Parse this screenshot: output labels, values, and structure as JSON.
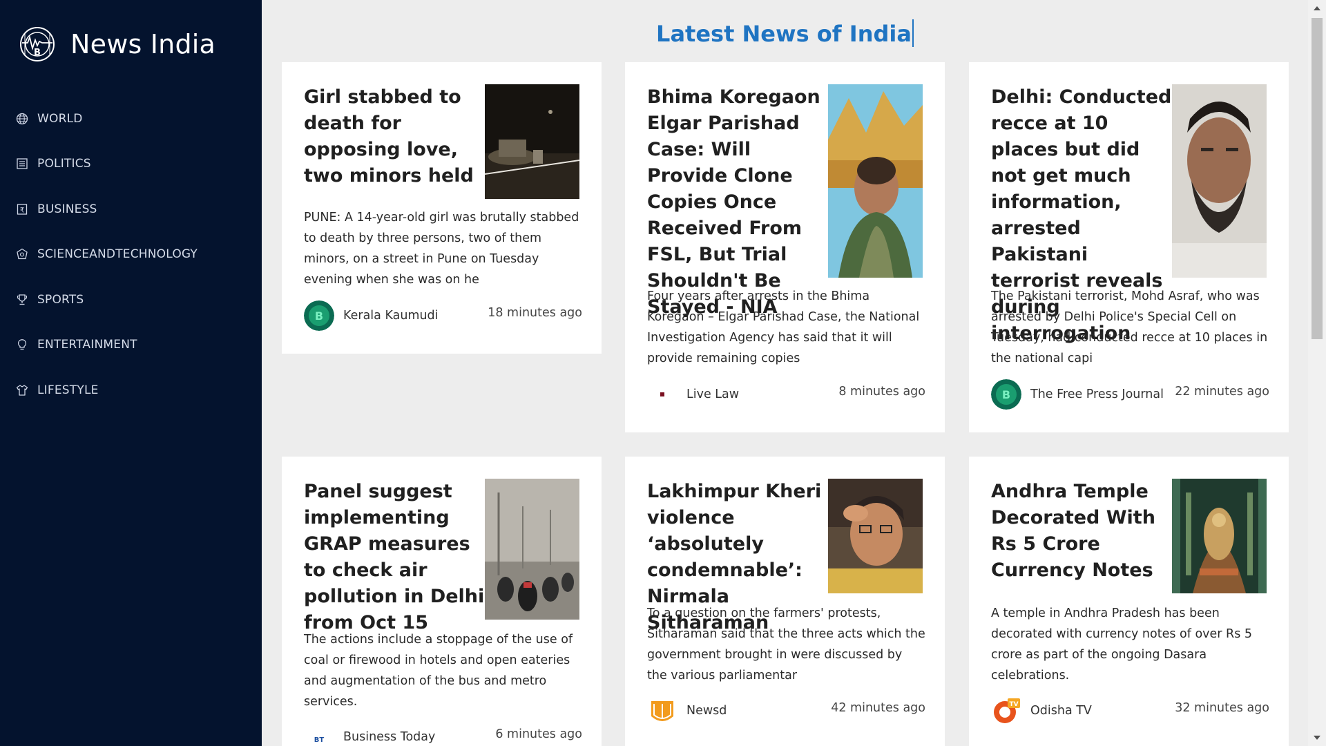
{
  "brand": {
    "name": "News India"
  },
  "nav": [
    {
      "label": "WORLD",
      "icon": "globe-icon"
    },
    {
      "label": "POLITICS",
      "icon": "building-icon"
    },
    {
      "label": "BUSINESS",
      "icon": "rupee-icon"
    },
    {
      "label": "SCIENCEANDTECHNOLOGY",
      "icon": "atom-icon"
    },
    {
      "label": "SPORTS",
      "icon": "trophy-icon"
    },
    {
      "label": "ENTERTAINMENT",
      "icon": "bulb-icon"
    },
    {
      "label": "LIFESTYLE",
      "icon": "shirt-icon"
    }
  ],
  "page": {
    "title": "Latest News of India"
  },
  "articles": [
    {
      "title": "Girl stabbed to death for opposing love, two minors held",
      "description": "PUNE: A 14-year-old girl was brutally stabbed to death by three persons, two of them minors, on a street in Pune on Tuesday evening when she was on he",
      "source": "Kerala Kaumudi",
      "time": "18 minutes ago"
    },
    {
      "title": "Bhima Koregaon Elgar Parishad Case: Will Provide Clone Copies Once Received From FSL, But Trial Shouldn't Be Stayed - NIA",
      "description": "Four years after arrests in the Bhima Koregaon – Elgar Parishad Case, the National Investigation Agency has said that it will provide remaining copies",
      "source": "Live Law",
      "time": "8 minutes ago"
    },
    {
      "title": "Delhi: Conducted recce at 10 places but did not get much information, arrested Pakistani terrorist reveals during interrogation",
      "description": "The Pakistani terrorist, Mohd Asraf, who was arrested by Delhi Police's Special Cell on Tuesday, had conducted recce at 10 places in the national capi",
      "source": "The Free Press Journal",
      "time": "22 minutes ago"
    },
    {
      "title": "Panel suggest implementing GRAP measures to check air pollution in Delhi from Oct 15",
      "description": "The actions include a stoppage of the use of coal or firewood in hotels and open eateries and augmentation of the bus and metro services.",
      "source": "Business Today",
      "source_logo_text": "BT",
      "time": "6 minutes ago"
    },
    {
      "title": "Lakhimpur Kheri violence ‘absolutely condemnable’: Nirmala Sitharaman",
      "description": "To a question on the farmers' protests, Sitharaman said that the three acts which the government brought in were discussed by the various parliamentar",
      "source": "Newsd",
      "time": "42 minutes ago"
    },
    {
      "title": "Andhra Temple Decorated With Rs 5 Crore Currency Notes",
      "description": "A temple in Andhra Pradesh has been decorated with currency notes of over Rs 5 crore as part of the ongoing Dasara celebrations.",
      "source": "Odisha TV",
      "source_logo_text": "TV",
      "time": "32 minutes ago"
    }
  ],
  "colors": {
    "sidebar_bg": "#04132e",
    "title_blue": "#1f74c2",
    "page_bg": "#ededed",
    "card_bg": "#ffffff"
  }
}
